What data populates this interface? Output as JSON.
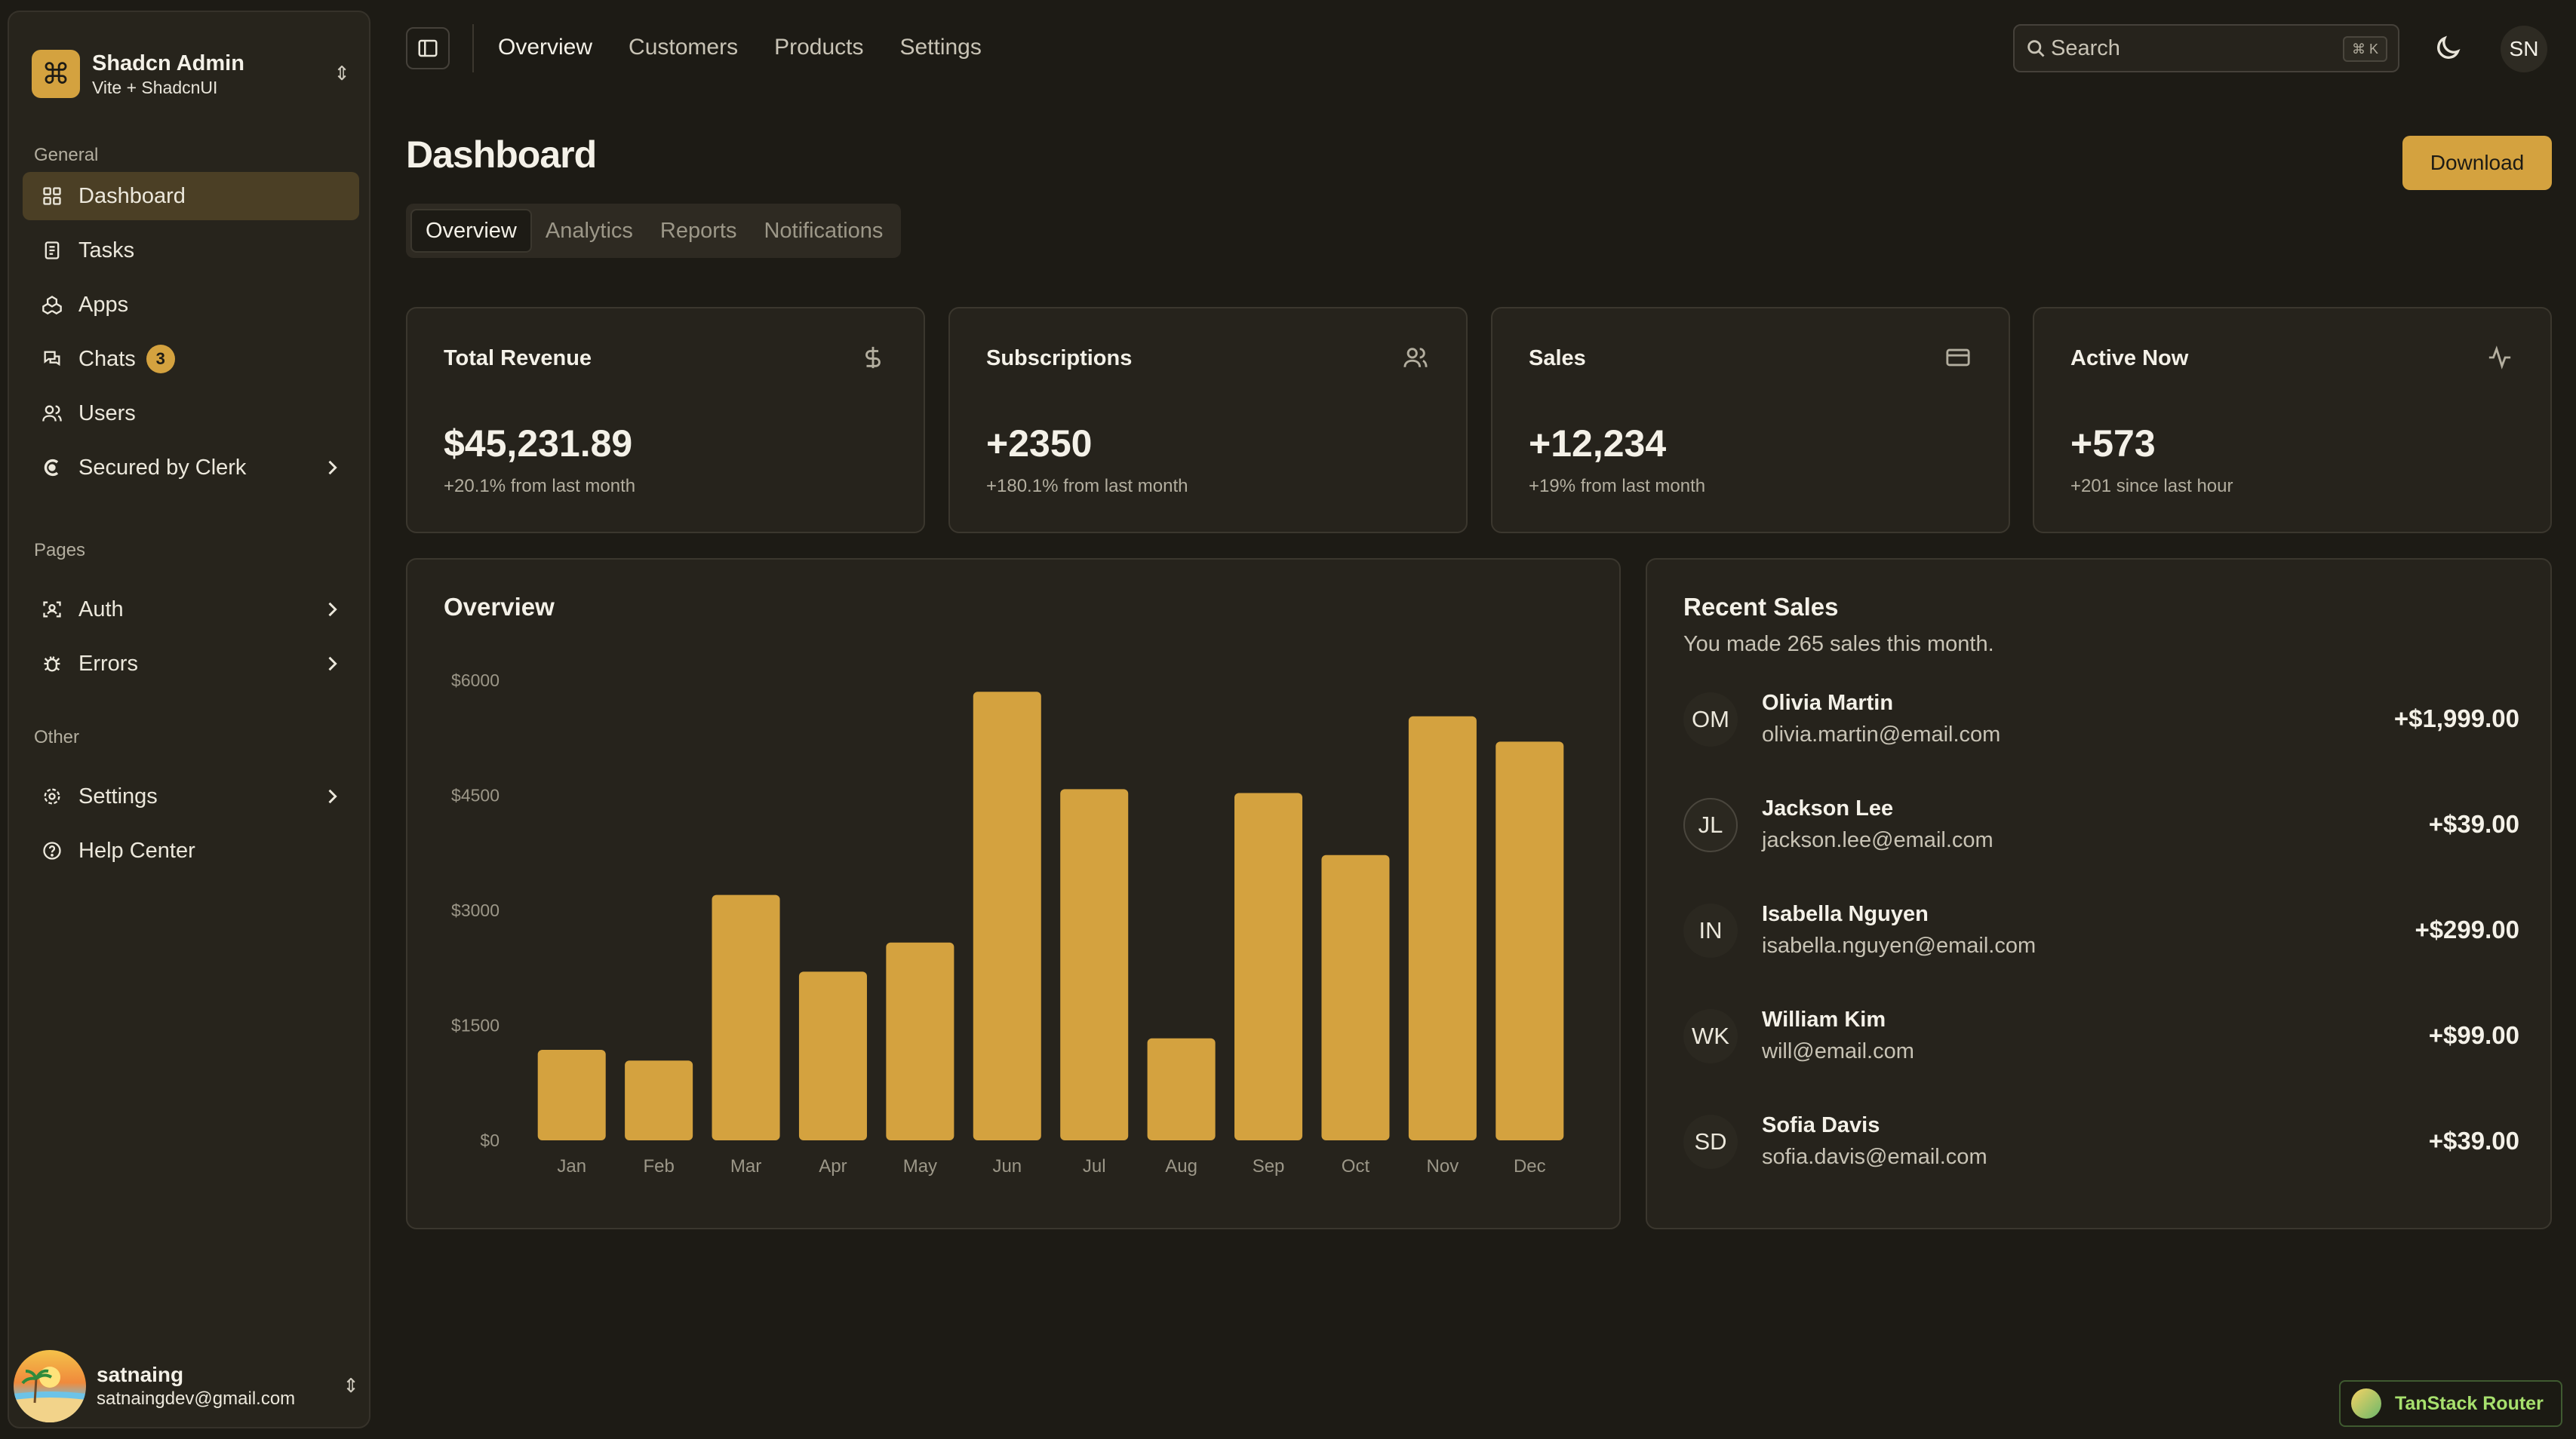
{
  "brand": {
    "title": "Shadcn Admin",
    "subtitle": "Vite + ShadcnUI",
    "logo_icon": "command-icon"
  },
  "sidebar": {
    "groups": [
      {
        "label": "General",
        "items": [
          {
            "label": "Dashboard",
            "icon": "layout-grid-icon",
            "active": true
          },
          {
            "label": "Tasks",
            "icon": "checklist-icon"
          },
          {
            "label": "Apps",
            "icon": "packages-icon"
          },
          {
            "label": "Chats",
            "icon": "messages-icon",
            "badge": "3"
          },
          {
            "label": "Users",
            "icon": "users-icon"
          },
          {
            "label": "Secured by Clerk",
            "icon": "clerk-icon",
            "has_children": true
          }
        ]
      },
      {
        "label": "Pages",
        "items": [
          {
            "label": "Auth",
            "icon": "user-scan-icon",
            "has_children": true
          },
          {
            "label": "Errors",
            "icon": "bug-icon",
            "has_children": true
          }
        ]
      },
      {
        "label": "Other",
        "items": [
          {
            "label": "Settings",
            "icon": "gear-icon",
            "has_children": true
          },
          {
            "label": "Help Center",
            "icon": "help-circle-icon"
          }
        ]
      }
    ]
  },
  "user": {
    "name": "satnaing",
    "email": "satnaingdev@gmail.com"
  },
  "topnav": {
    "links": [
      "Overview",
      "Customers",
      "Products",
      "Settings"
    ],
    "active": "Overview"
  },
  "search": {
    "placeholder": "Search",
    "shortcut": "⌘ K"
  },
  "header_avatar": "SN",
  "page": {
    "title": "Dashboard",
    "download_label": "Download"
  },
  "tabs": {
    "items": [
      "Overview",
      "Analytics",
      "Reports",
      "Notifications"
    ],
    "active": "Overview"
  },
  "stats": [
    {
      "title": "Total Revenue",
      "value": "$45,231.89",
      "note": "+20.1% from last month",
      "icon": "dollar-icon"
    },
    {
      "title": "Subscriptions",
      "value": "+2350",
      "note": "+180.1% from last month",
      "icon": "users-icon"
    },
    {
      "title": "Sales",
      "value": "+12,234",
      "note": "+19% from last month",
      "icon": "credit-card-icon"
    },
    {
      "title": "Active Now",
      "value": "+573",
      "note": "+201 since last hour",
      "icon": "activity-icon"
    }
  ],
  "overview": {
    "title": "Overview"
  },
  "chart_data": {
    "type": "bar",
    "title": "Overview",
    "categories": [
      "Jan",
      "Feb",
      "Mar",
      "Apr",
      "May",
      "Jun",
      "Jul",
      "Aug",
      "Sep",
      "Oct",
      "Nov",
      "Dec"
    ],
    "values": [
      1180,
      1040,
      3200,
      2200,
      2580,
      5850,
      4580,
      1330,
      4530,
      3720,
      5530,
      5200
    ],
    "y_ticks": [
      "$0",
      "$1500",
      "$3000",
      "$4500",
      "$6000"
    ],
    "y_tick_values": [
      0,
      1500,
      3000,
      4500,
      6000
    ],
    "ylim": [
      0,
      6000
    ],
    "grid": false,
    "color": "#d4a23f"
  },
  "recent_sales": {
    "title": "Recent Sales",
    "subtitle": "You made 265 sales this month.",
    "items": [
      {
        "initials": "OM",
        "name": "Olivia Martin",
        "email": "olivia.martin@email.com",
        "amount": "+$1,999.00"
      },
      {
        "initials": "JL",
        "name": "Jackson Lee",
        "email": "jackson.lee@email.com",
        "amount": "+$39.00"
      },
      {
        "initials": "IN",
        "name": "Isabella Nguyen",
        "email": "isabella.nguyen@email.com",
        "amount": "+$299.00"
      },
      {
        "initials": "WK",
        "name": "William Kim",
        "email": "will@email.com",
        "amount": "+$99.00"
      },
      {
        "initials": "SD",
        "name": "Sofia Davis",
        "email": "sofia.davis@email.com",
        "amount": "+$39.00"
      }
    ]
  },
  "devtools": {
    "label": "TanStack Router"
  },
  "colors": {
    "accent": "#d4a23f",
    "background": "#1d1b15",
    "card": "#26231c"
  }
}
